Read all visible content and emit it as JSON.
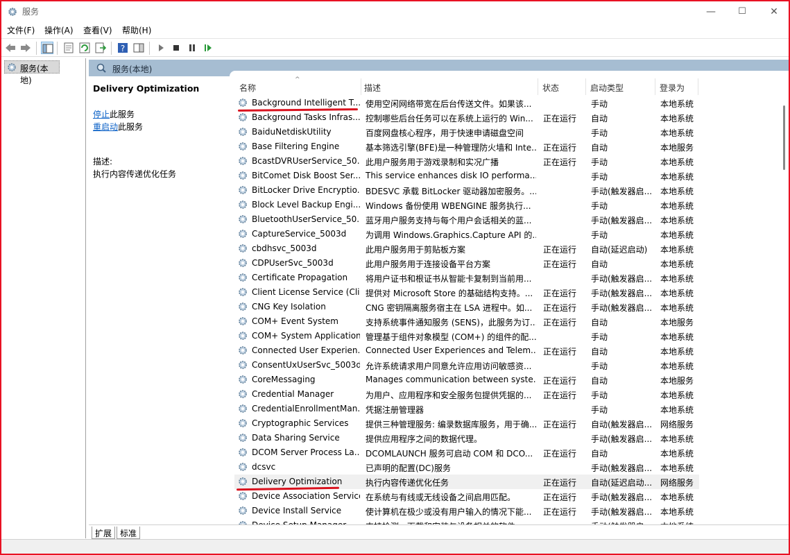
{
  "window": {
    "title": "服务",
    "minimize": "—",
    "maximize": "☐",
    "close": "✕"
  },
  "menu": [
    "文件(F)",
    "操作(A)",
    "查看(V)",
    "帮助(H)"
  ],
  "tree": {
    "item": "服务(本地)"
  },
  "header": {
    "label": "服务(本地)"
  },
  "info": {
    "title": "Delivery Optimization",
    "stop_link": "停止",
    "stop_suffix": "此服务",
    "restart_link": "重启动",
    "restart_suffix": "此服务",
    "desc_label": "描述:",
    "desc_text": "执行内容传递优化任务"
  },
  "columns": {
    "name": "名称",
    "desc": "描述",
    "status": "状态",
    "startup": "启动类型",
    "logon": "登录为"
  },
  "services": [
    [
      "Background Intelligent T...",
      "使用空闲网络带宽在后台传送文件。如果该...",
      "",
      "手动",
      "本地系统"
    ],
    [
      "Background Tasks Infras...",
      "控制哪些后台任务可以在系统上运行的 Win...",
      "正在运行",
      "自动",
      "本地系统"
    ],
    [
      "BaiduNetdiskUtility",
      "百度网盘核心程序，用于快速申请磁盘空间",
      "",
      "手动",
      "本地系统"
    ],
    [
      "Base Filtering Engine",
      "基本筛选引擎(BFE)是一种管理防火墙和 Inte...",
      "正在运行",
      "自动",
      "本地服务"
    ],
    [
      "BcastDVRUserService_50...",
      "此用户服务用于游戏录制和实况广播",
      "正在运行",
      "手动",
      "本地系统"
    ],
    [
      "BitComet Disk Boost Ser...",
      "This service enhances disk IO performa...",
      "",
      "手动",
      "本地系统"
    ],
    [
      "BitLocker Drive Encryptio...",
      "BDESVC 承载 BitLocker 驱动器加密服务。...",
      "",
      "手动(触发器启...",
      "本地系统"
    ],
    [
      "Block Level Backup Engi...",
      "Windows 备份使用 WBENGINE 服务执行...",
      "",
      "手动",
      "本地系统"
    ],
    [
      "BluetoothUserService_50...",
      "蓝牙用户服务支持与每个用户会话相关的蓝...",
      "",
      "手动(触发器启...",
      "本地系统"
    ],
    [
      "CaptureService_5003d",
      "为调用 Windows.Graphics.Capture API 的...",
      "",
      "手动",
      "本地系统"
    ],
    [
      "cbdhsvc_5003d",
      "此用户服务用于剪贴板方案",
      "正在运行",
      "自动(延迟启动)",
      "本地系统"
    ],
    [
      "CDPUserSvc_5003d",
      "此用户服务用于连接设备平台方案",
      "正在运行",
      "自动",
      "本地系统"
    ],
    [
      "Certificate Propagation",
      "将用户证书和根证书从智能卡复制到当前用...",
      "",
      "手动(触发器启...",
      "本地系统"
    ],
    [
      "Client License Service (Cli...",
      "提供对 Microsoft Store 的基础结构支持。...",
      "正在运行",
      "手动(触发器启...",
      "本地系统"
    ],
    [
      "CNG Key Isolation",
      "CNG 密钥隔离服务宿主在 LSA 进程中。如...",
      "正在运行",
      "手动(触发器启...",
      "本地系统"
    ],
    [
      "COM+ Event System",
      "支持系统事件通知服务 (SENS)，此服务为订...",
      "正在运行",
      "自动",
      "本地服务"
    ],
    [
      "COM+ System Application",
      "管理基于组件对象模型 (COM+) 的组件的配...",
      "",
      "手动",
      "本地系统"
    ],
    [
      "Connected User Experien...",
      "Connected User Experiences and Telem...",
      "正在运行",
      "自动",
      "本地系统"
    ],
    [
      "ConsentUxUserSvc_5003d",
      "允许系统请求用户同意允许应用访问敏感资...",
      "",
      "手动",
      "本地系统"
    ],
    [
      "CoreMessaging",
      "Manages communication between syste...",
      "正在运行",
      "自动",
      "本地服务"
    ],
    [
      "Credential Manager",
      "为用户、应用程序和安全服务包提供凭据的...",
      "正在运行",
      "手动",
      "本地系统"
    ],
    [
      "CredentialEnrollmentMan...",
      "凭据注册管理器",
      "",
      "手动",
      "本地系统"
    ],
    [
      "Cryptographic Services",
      "提供三种管理服务: 编录数据库服务，用于确...",
      "正在运行",
      "自动(触发器启...",
      "网络服务"
    ],
    [
      "Data Sharing Service",
      "提供应用程序之间的数据代理。",
      "",
      "手动(触发器启...",
      "本地系统"
    ],
    [
      "DCOM Server Process La...",
      "DCOMLAUNCH 服务可启动 COM 和 DCO...",
      "正在运行",
      "自动",
      "本地系统"
    ],
    [
      "dcsvc",
      "已声明的配置(DC)服务",
      "",
      "手动(触发器启...",
      "本地系统"
    ],
    [
      "Delivery Optimization",
      "执行内容传递优化任务",
      "正在运行",
      "自动(延迟启动...",
      "网络服务"
    ],
    [
      "Device Association Service",
      "在系统与有线或无线设备之间启用匹配。",
      "正在运行",
      "手动(触发器启...",
      "本地系统"
    ],
    [
      "Device Install Service",
      "使计算机在极少或没有用户输入的情况下能...",
      "正在运行",
      "手动(触发器启...",
      "本地系统"
    ],
    [
      "Device Setup Manager",
      "支持检测、下载和安装与设备相关的软件。",
      "",
      "手动(触发器启...",
      "本地系统"
    ]
  ],
  "selected_index": 26,
  "tabs": [
    "扩展",
    "标准"
  ],
  "colors": {
    "header": "#a6bdd2",
    "link": "#0b61c7",
    "annotation": "#d9121e",
    "window_border": "#e81123"
  }
}
